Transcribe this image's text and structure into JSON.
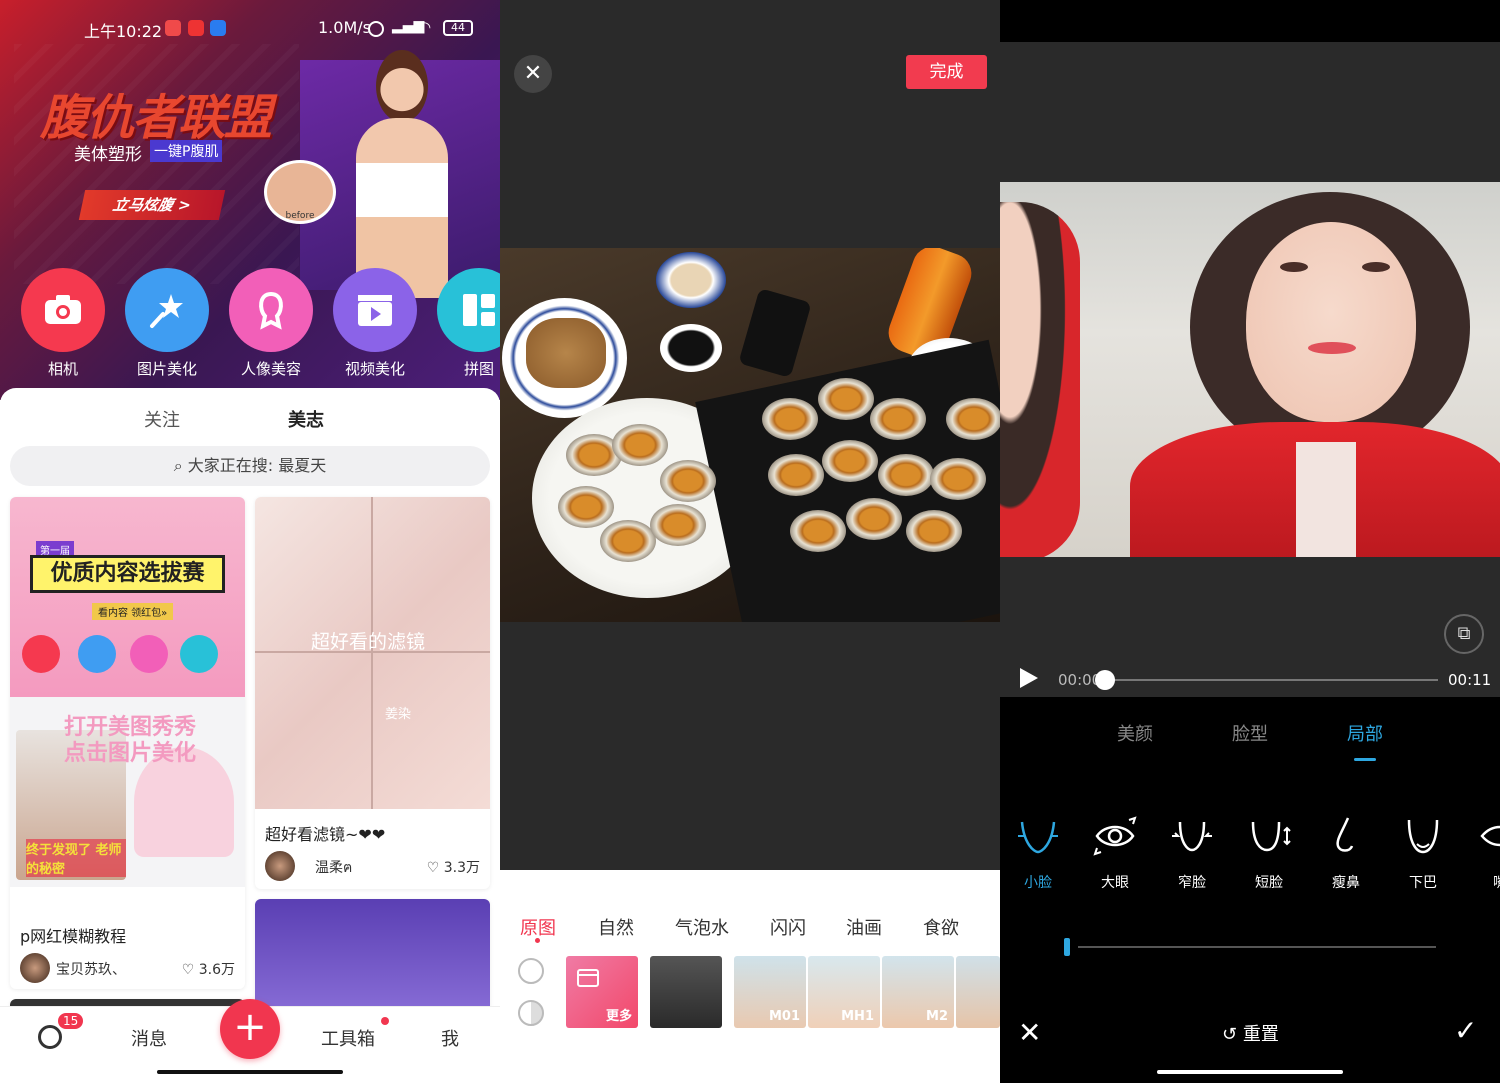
{
  "home": {
    "status": {
      "time": "上午10:22",
      "rate": "1.0M/s",
      "battery": "44"
    },
    "banner": {
      "title": "腹仇者联盟",
      "subtitle": "美体塑形",
      "tag": "一键P腹肌",
      "cta": "立马炫腹 >",
      "before_label": "before"
    },
    "shortcuts": [
      {
        "label": "相机",
        "icon": "camera-icon",
        "color": "#f5394f"
      },
      {
        "label": "图片美化",
        "icon": "magic-wand-icon",
        "color": "#3f9df2"
      },
      {
        "label": "人像美容",
        "icon": "portrait-icon",
        "color": "#f25fb8"
      },
      {
        "label": "视频美化",
        "icon": "video-icon",
        "color": "#8b63e8"
      },
      {
        "label": "拼图",
        "icon": "collage-icon",
        "color": "#28c1d8"
      }
    ],
    "tabs": [
      {
        "label": "关注"
      },
      {
        "label": "美志"
      }
    ],
    "search_placeholder": "大家正在搜: 最夏天",
    "cards": [
      {
        "promo_title": "优质内容选拔赛",
        "promo_badge": "第一届",
        "promo_cta": "看内容 领红包»",
        "overlay": "打开美图秀秀 点击图片美化",
        "sticker": "终于发现了 老师的秘密",
        "title": "p网红模糊教程",
        "author": "宝贝苏玖、",
        "likes": "3.6万"
      },
      {
        "overlay": "超好看的滤镜",
        "overlay2": "姜染",
        "title": "超好看滤镜~❤❤",
        "author": "温柔ฅ",
        "likes": "3.3万"
      }
    ],
    "nav": {
      "messages": "消息",
      "toolbox": "工具箱",
      "me": "我",
      "badge": "15",
      "plus": "+"
    }
  },
  "editor": {
    "close": "✕",
    "done": "完成",
    "filter_tabs": [
      "原图",
      "自然",
      "气泡水",
      "闪闪",
      "油画",
      "食欲"
    ],
    "more": "更多",
    "thumbs": [
      "M01",
      "MH1",
      "M2"
    ]
  },
  "beauty": {
    "time_current": "00:00",
    "time_total": "00:11",
    "progress": 0,
    "tabs": [
      "美颜",
      "脸型",
      "局部"
    ],
    "tools": [
      "小脸",
      "大眼",
      "窄脸",
      "短脸",
      "瘦鼻",
      "下巴",
      "嘴"
    ],
    "reset": "重置",
    "accent": "#2ea7e0"
  }
}
